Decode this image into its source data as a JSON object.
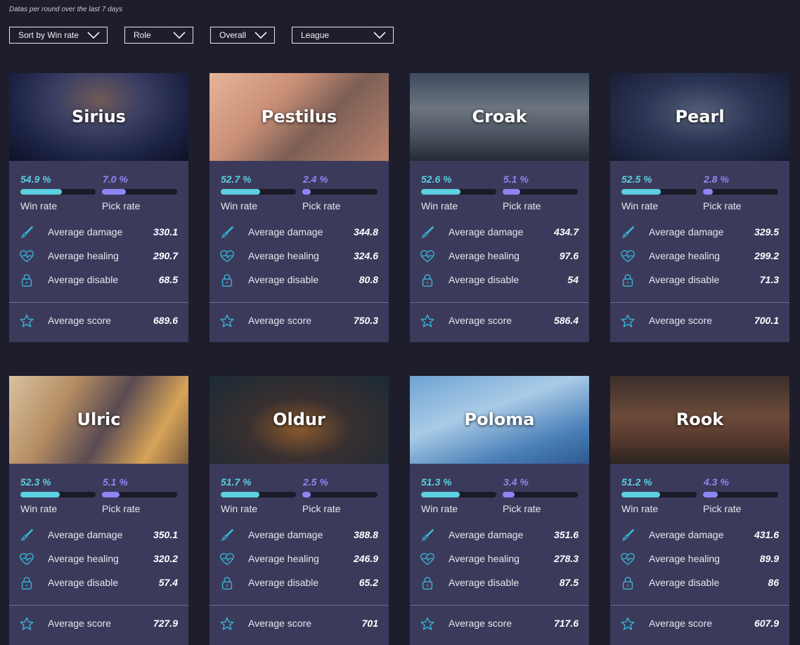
{
  "subtitle": "Datas per round over the last 7 days",
  "filters": [
    {
      "label": "Sort by Win rate"
    },
    {
      "label": "Role"
    },
    {
      "label": "Overall"
    },
    {
      "label": "League"
    }
  ],
  "labels": {
    "win_rate": "Win rate",
    "pick_rate": "Pick rate",
    "avg_damage": "Average damage",
    "avg_healing": "Average healing",
    "avg_disable": "Average disable",
    "avg_score": "Average score"
  },
  "colors": {
    "background": "#1e1d2b",
    "card": "#3c3a5b",
    "win_rate": "#5bd0e0",
    "pick_rate": "#8c86f5",
    "icon": "#37b6d6"
  },
  "champions": [
    {
      "name": "Sirius",
      "win_rate": "54.9 %",
      "win_value": 54.9,
      "pick_rate": "7.0 %",
      "pick_value": 7.0,
      "damage": "330.1",
      "healing": "290.7",
      "disable": "68.5",
      "score": "689.6"
    },
    {
      "name": "Pestilus",
      "win_rate": "52.7 %",
      "win_value": 52.7,
      "pick_rate": "2.4 %",
      "pick_value": 2.4,
      "damage": "344.8",
      "healing": "324.6",
      "disable": "80.8",
      "score": "750.3"
    },
    {
      "name": "Croak",
      "win_rate": "52.6 %",
      "win_value": 52.6,
      "pick_rate": "5.1 %",
      "pick_value": 5.1,
      "damage": "434.7",
      "healing": "97.6",
      "disable": "54",
      "score": "586.4"
    },
    {
      "name": "Pearl",
      "win_rate": "52.5 %",
      "win_value": 52.5,
      "pick_rate": "2.8 %",
      "pick_value": 2.8,
      "damage": "329.5",
      "healing": "299.2",
      "disable": "71.3",
      "score": "700.1"
    },
    {
      "name": "Ulric",
      "win_rate": "52.3 %",
      "win_value": 52.3,
      "pick_rate": "5.1 %",
      "pick_value": 5.1,
      "damage": "350.1",
      "healing": "320.2",
      "disable": "57.4",
      "score": "727.9"
    },
    {
      "name": "Oldur",
      "win_rate": "51.7 %",
      "win_value": 51.7,
      "pick_rate": "2.5 %",
      "pick_value": 2.5,
      "damage": "388.8",
      "healing": "246.9",
      "disable": "65.2",
      "score": "701"
    },
    {
      "name": "Poloma",
      "win_rate": "51.3 %",
      "win_value": 51.3,
      "pick_rate": "3.4 %",
      "pick_value": 3.4,
      "damage": "351.6",
      "healing": "278.3",
      "disable": "87.5",
      "score": "717.6"
    },
    {
      "name": "Rook",
      "win_rate": "51.2 %",
      "win_value": 51.2,
      "pick_rate": "4.3 %",
      "pick_value": 4.3,
      "damage": "431.6",
      "healing": "89.9",
      "disable": "86",
      "score": "607.9"
    }
  ],
  "icons": {
    "damage": "sword-icon",
    "healing": "heart-pulse-icon",
    "disable": "lock-icon",
    "score": "star-icon",
    "dropdown": "chevron-down-icon"
  }
}
